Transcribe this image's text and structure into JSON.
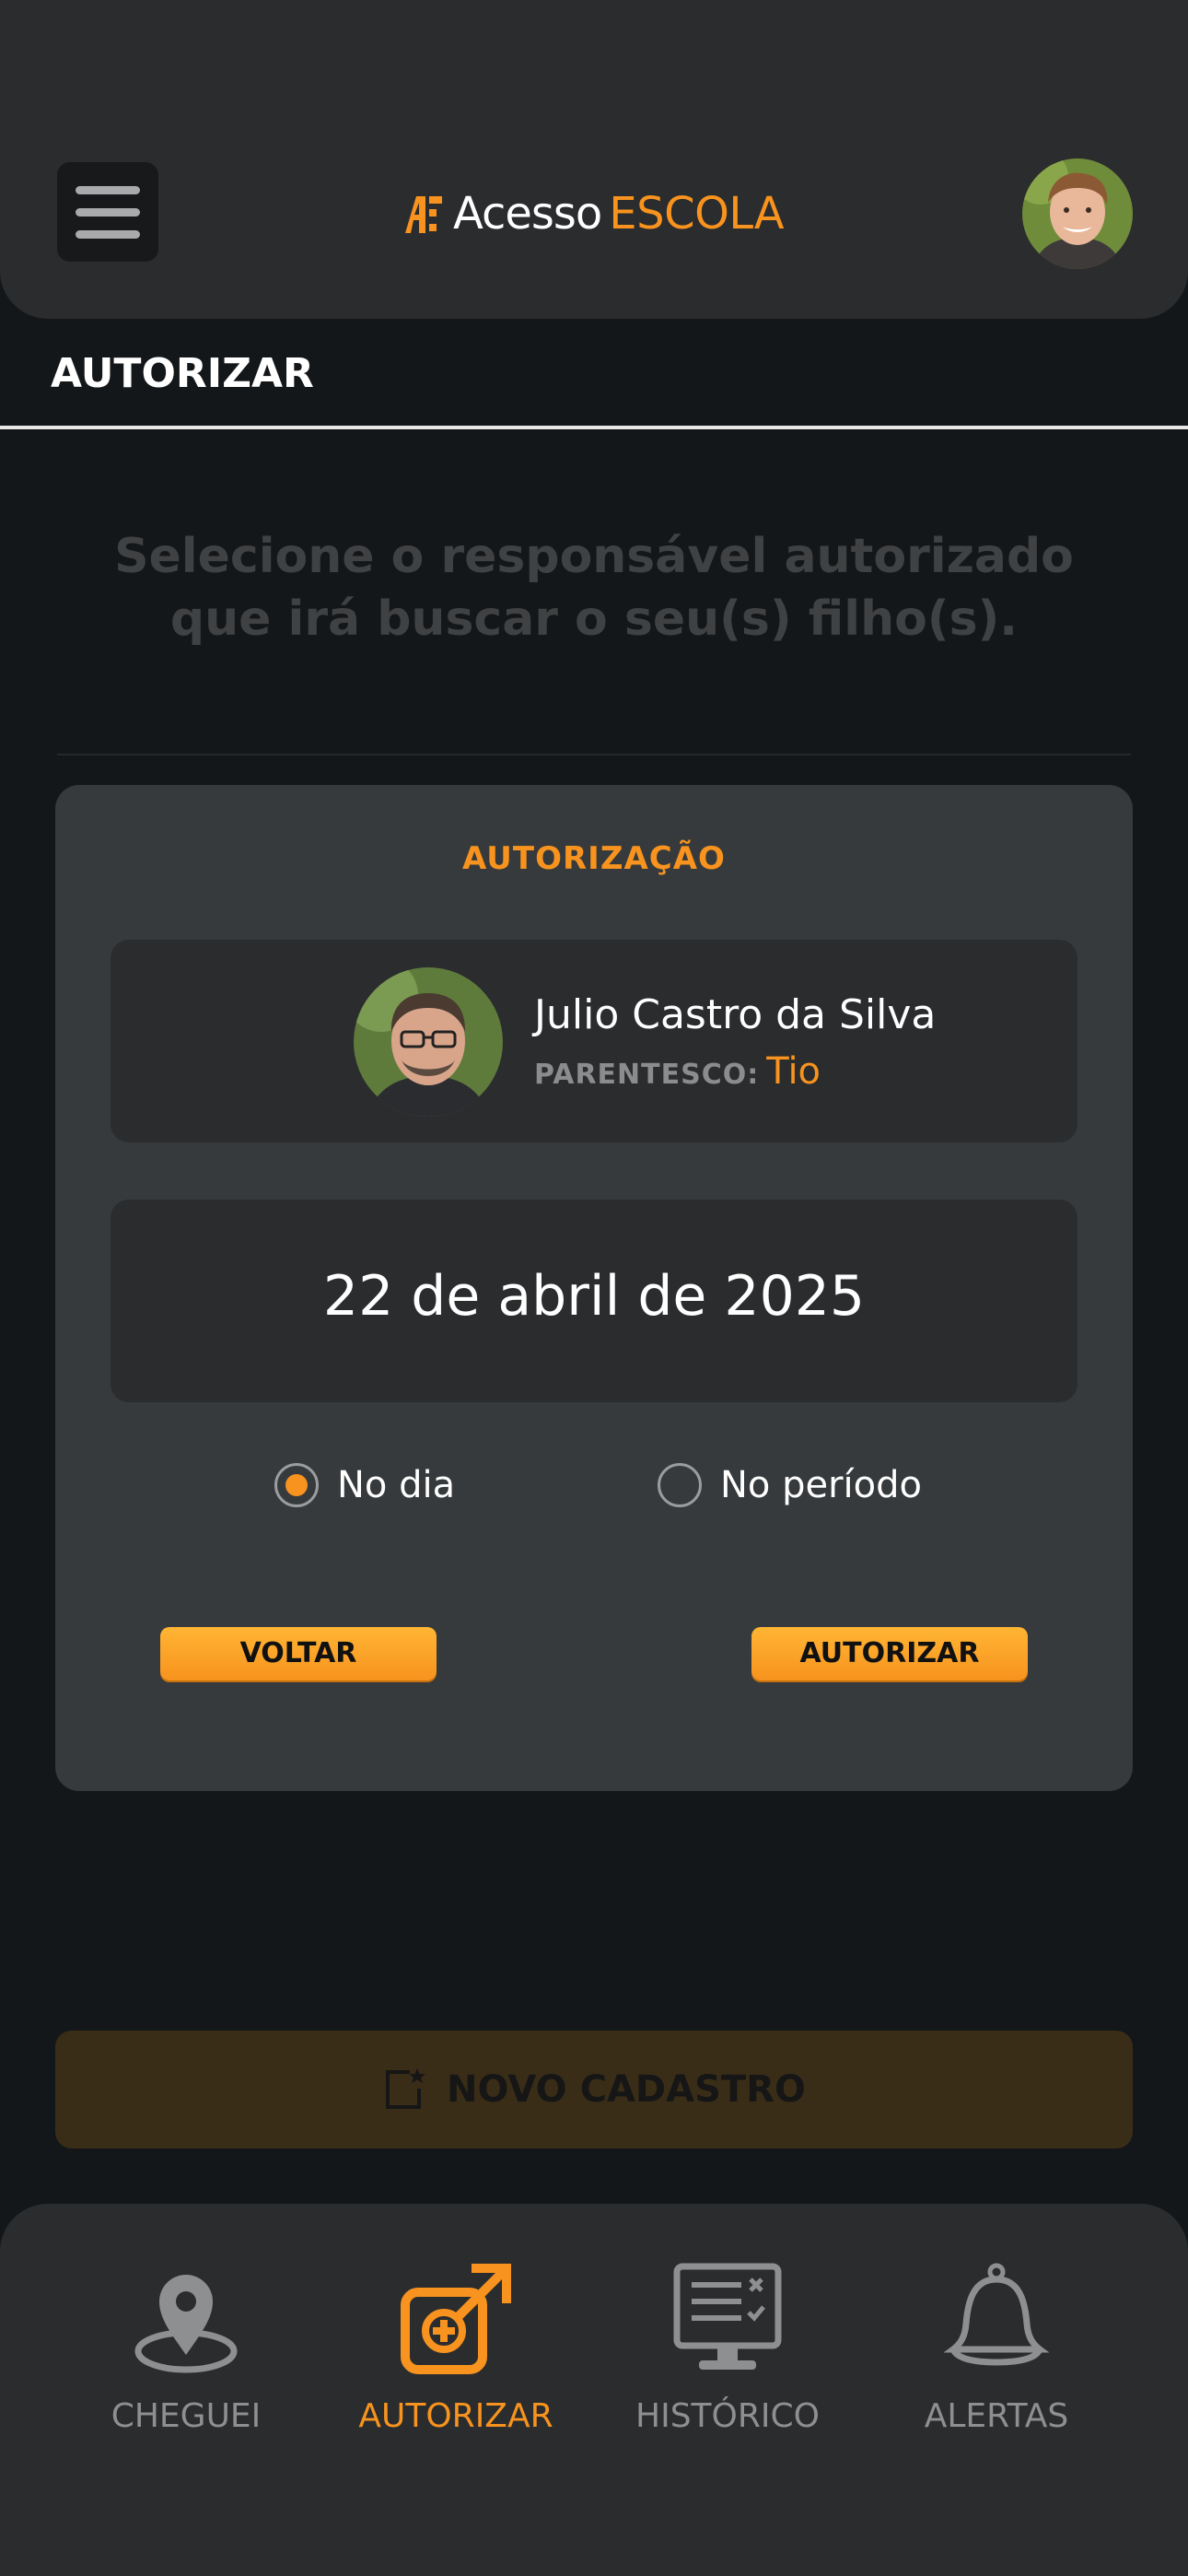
{
  "header": {
    "logo_part1": "Acesso",
    "logo_part2": "ESCOLA"
  },
  "section_title": "AUTORIZAR",
  "instruction_line1": "Selecione o responsável autorizado",
  "instruction_line2": "que irá buscar o seu(s) filho(s).",
  "card": {
    "title": "AUTORIZAÇÃO",
    "person_name": "Julio Castro da Silva",
    "relationship_label": "PARENTESCO:",
    "relationship_value": "Tio",
    "date": "22 de abril de 2025",
    "option_day": "No dia",
    "option_period": "No período",
    "selected_option": "No dia",
    "back_label": "VOLTAR",
    "authorize_label": "AUTORIZAR"
  },
  "new_register_label": "NOVO CADASTRO",
  "tabs": [
    {
      "label": "CHEGUEI",
      "icon": "location-pin-icon",
      "active": false
    },
    {
      "label": "AUTORIZAR",
      "icon": "authorize-icon",
      "active": true
    },
    {
      "label": "HISTÓRICO",
      "icon": "history-monitor-icon",
      "active": false
    },
    {
      "label": "ALERTAS",
      "icon": "bell-icon",
      "active": false
    }
  ],
  "colors": {
    "accent": "#f7931e",
    "background": "#141719",
    "surface": "#2b2c2e",
    "card": "#363a3c"
  }
}
